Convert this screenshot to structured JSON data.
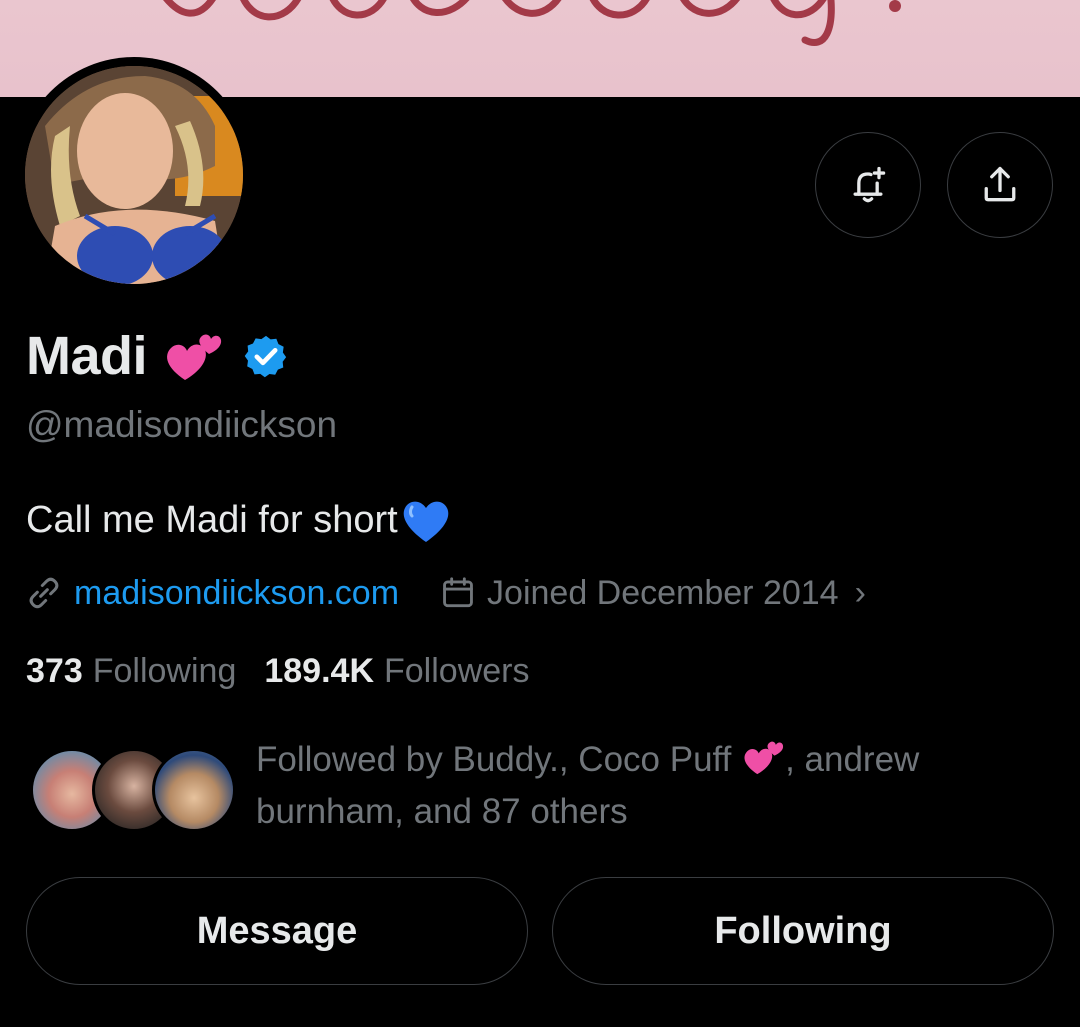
{
  "banner": {
    "script_text": ""
  },
  "header_actions": {
    "notify_icon": "bell-plus-icon",
    "share_icon": "share-icon"
  },
  "profile": {
    "name": "Madi",
    "name_emoji": "two-hearts-emoji",
    "verified": true,
    "verified_color": "#1d9bf0",
    "handle": "@madisondiickson",
    "bio": "Call me Madi for short",
    "bio_emoji": "blue-heart-emoji",
    "website": "madisondiickson.com",
    "joined": "Joined December 2014",
    "joined_chevron": "›"
  },
  "stats": {
    "following_count": "373",
    "following_label": "Following",
    "followers_count": "189.4K",
    "followers_label": "Followers"
  },
  "followed_by": {
    "part1": "Followed by Buddy., Coco Puff ",
    "part2": ", andrew burnham, and 87 others"
  },
  "actions": {
    "message_label": "Message",
    "following_label": "Following"
  },
  "colors": {
    "accent": "#1d9bf0",
    "secondary_text": "#71767b",
    "banner": "#eac6cf"
  }
}
